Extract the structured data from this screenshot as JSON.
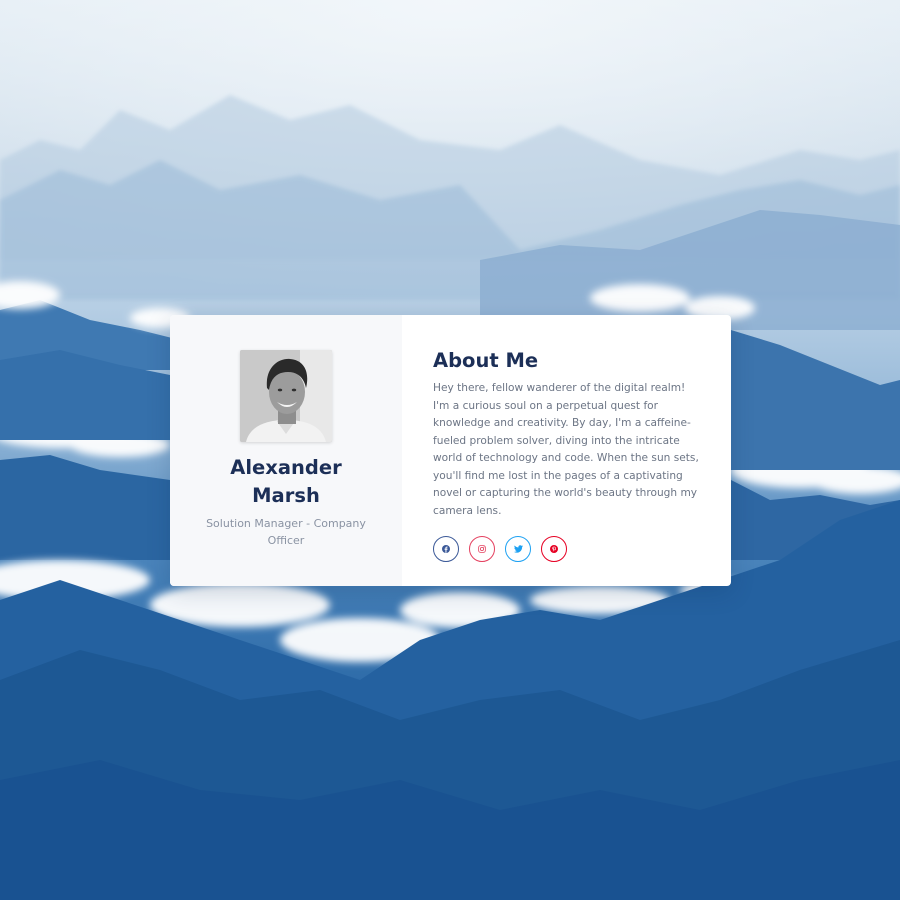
{
  "profile": {
    "name": "Alexander Marsh",
    "role": "Solution Manager - Company Officer"
  },
  "about": {
    "title": "About Me",
    "text": "Hey there, fellow wanderer of the digital realm! I'm a curious soul on a perpetual quest for knowledge and creativity. By day, I'm a caffeine-fueled problem solver, diving into the intricate world of technology and code. When the sun sets, you'll find me lost in the pages of a captivating novel or capturing the world's beauty through my camera lens."
  },
  "socials": [
    {
      "icon": "facebook-icon",
      "color": "#3b5998"
    },
    {
      "icon": "instagram-icon",
      "color": "#e4405f"
    },
    {
      "icon": "twitter-icon",
      "color": "#1da1f2"
    },
    {
      "icon": "pinterest-icon",
      "color": "#e60023"
    }
  ],
  "colors": {
    "heading": "#1c2f57",
    "body_text": "#6c7585",
    "card_left_bg": "#f7f8fa"
  }
}
